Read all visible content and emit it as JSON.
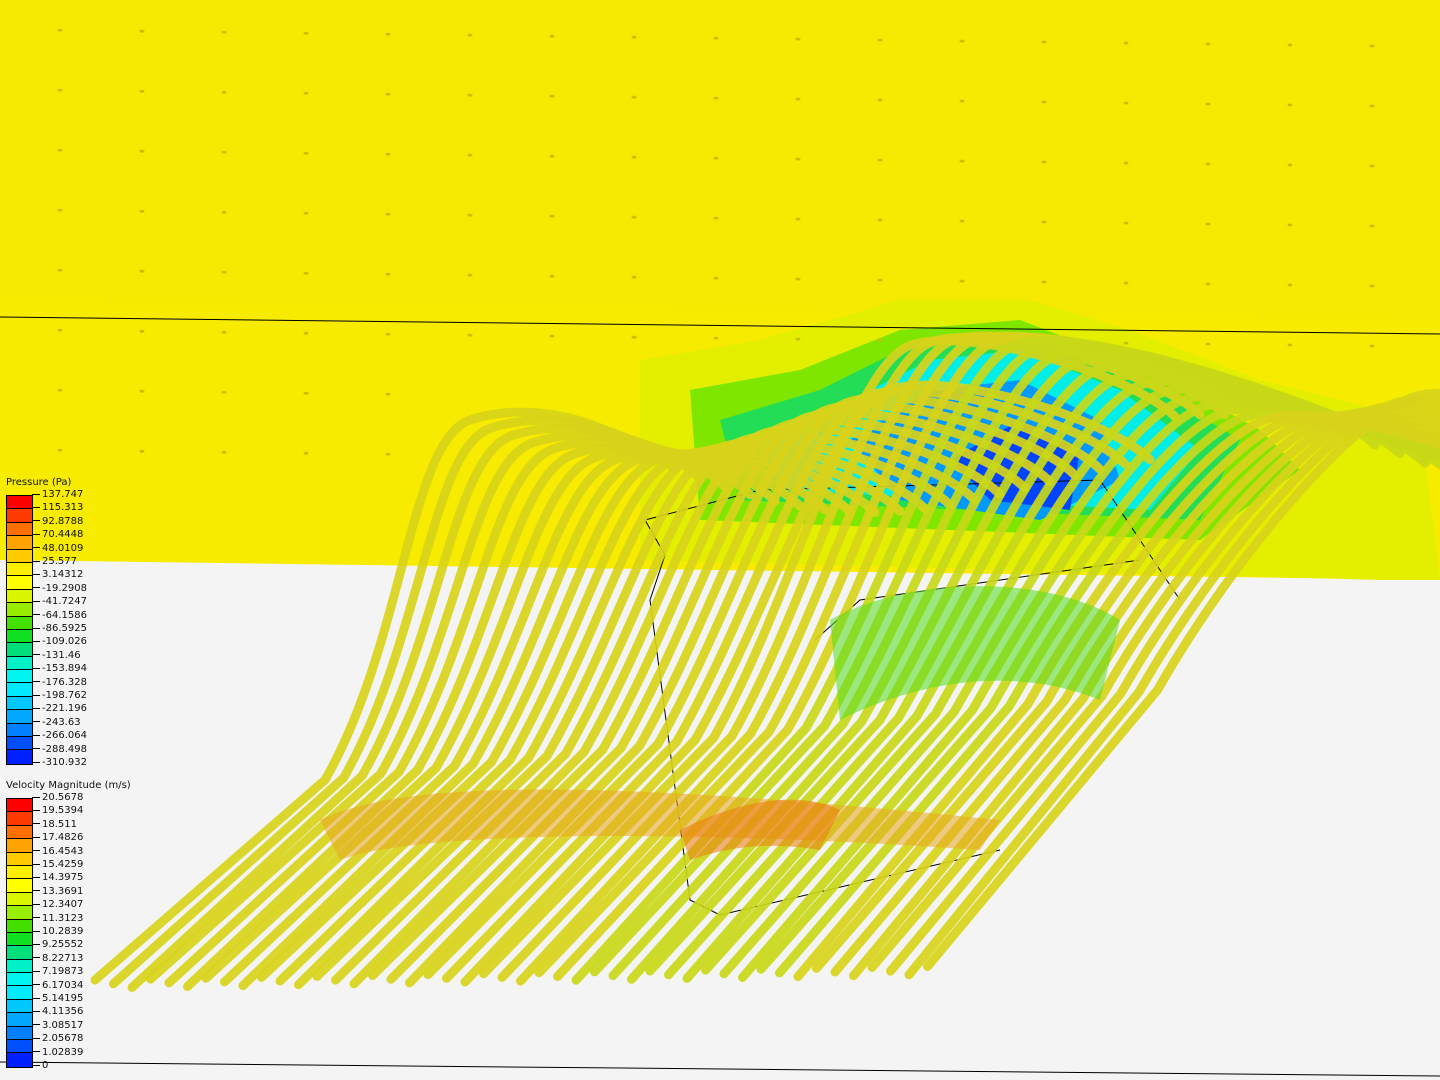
{
  "viewport": {
    "background_upper": "#f5ea00",
    "background_lower": "#f4f4f4",
    "streamline_color": "#d8d21a"
  },
  "pressure_legend": {
    "title": "Pressure (Pa)",
    "labels": [
      "137.747",
      "115.313",
      "92.8788",
      "70.4448",
      "48.0109",
      "25.577",
      "3.14312",
      "-19.2908",
      "-41.7247",
      "-64.1586",
      "-86.5925",
      "-109.026",
      "-131.46",
      "-153.894",
      "-176.328",
      "-198.762",
      "-221.196",
      "-243.63",
      "-266.064",
      "-288.498",
      "-310.932"
    ]
  },
  "velocity_legend": {
    "title": "Velocity Magnitude (m/s)",
    "labels": [
      "20.5678",
      "19.5394",
      "18.511",
      "17.4826",
      "16.4543",
      "15.4259",
      "14.3975",
      "13.3691",
      "12.3407",
      "11.3123",
      "10.2839",
      "9.25552",
      "8.22713",
      "7.19873",
      "6.17034",
      "5.14195",
      "4.11356",
      "3.08517",
      "2.05678",
      "1.02839",
      "0"
    ]
  },
  "colormap": [
    "#ff0000",
    "#ff3a00",
    "#ff7000",
    "#ffa300",
    "#ffcc00",
    "#ffee00",
    "#ffff00",
    "#d9f500",
    "#99ee00",
    "#44e000",
    "#11e020",
    "#00e07a",
    "#00f0c8",
    "#00f5f0",
    "#00eaff",
    "#00c8ff",
    "#00a8ff",
    "#0080ff",
    "#0050ff",
    "#0020ff"
  ]
}
